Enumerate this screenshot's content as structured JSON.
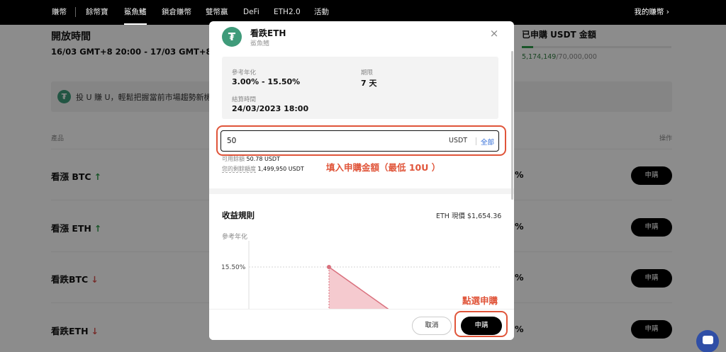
{
  "nav": {
    "items": [
      {
        "label": "賺幣",
        "active": false
      },
      {
        "label": "餘幣寶",
        "active": false
      },
      {
        "label": "鯊魚鰭",
        "active": true
      },
      {
        "label": "鎖倉賺幣",
        "active": false
      },
      {
        "label": "雙幣贏",
        "active": false
      },
      {
        "label": "DeFi",
        "active": false
      },
      {
        "label": "ETH2.0",
        "active": false
      },
      {
        "label": "活動",
        "active": false
      }
    ],
    "my_earn": "我的賺幣 ›"
  },
  "page": {
    "open_title": "開放時間",
    "open_range": "16/03 GMT+8 20:00 - 17/03 GMT+8 20:00",
    "subscribed_title": "已申購 USDT 金額",
    "subscribed_amount": "5,174,149",
    "subscribed_total": "/70,000,000",
    "subscribed_ratio": 0.074,
    "banner_icon": "₮",
    "banner_text": "投 U 賺 U，輕鬆把握當前市場趨勢新機",
    "col_product": "產品",
    "col_action": "操作",
    "products": [
      {
        "name": "看漲 BTC",
        "arrow": "↑",
        "dir": "up",
        "pct": "%",
        "button": "申購"
      },
      {
        "name": "看漲 ETH",
        "arrow": "↑",
        "dir": "up",
        "pct": "%",
        "button": "申購"
      },
      {
        "name": "看跌BTC",
        "arrow": "↓",
        "dir": "down",
        "pct": "%",
        "button": "申購"
      },
      {
        "name": "看跌ETH",
        "arrow": "↓",
        "dir": "down",
        "pct": "%",
        "button": "申購"
      }
    ]
  },
  "modal": {
    "icon": "₮",
    "title": "看跌ETH",
    "subtitle": "鯊魚鰭",
    "close_icon": "×",
    "apr_label": "參考年化",
    "apr_value": "3.00% - 15.50%",
    "term_label": "期限",
    "term_value": "7 天",
    "settle_label": "結算時間",
    "settle_value": "24/03/2023 18:00",
    "amount_value": "50",
    "amount_unit": "USDT",
    "amount_all": "全部",
    "available_label": "可用餘額",
    "available_value": "50.78 USDT",
    "quota_label": "您的剩餘額度",
    "quota_value": "1,499,950 USDT",
    "tip_amount": "填入申購金額（最低 10U ）",
    "rules_title": "收益規則",
    "price_now": "ETH 現價 $1,654.36",
    "chart_ylabel": "參考年化",
    "cancel_label": "取消",
    "subscribe_label": "申購",
    "tip_button": "點選申購"
  },
  "chart_data": {
    "type": "area",
    "ylabel": "參考年化",
    "ytick_labels": [
      "15.50%"
    ],
    "series": [
      {
        "points": [
          [
            0,
            15.5
          ],
          [
            1,
            3.0
          ]
        ]
      }
    ],
    "color": "#e8a0a8"
  },
  "colors": {
    "accent": "#e0553a",
    "tether": "#3f9b7a",
    "link": "#2f6bd7",
    "up": "#2e9b4a",
    "down": "#d9534f"
  },
  "icons": {
    "banner": "tether-icon",
    "modal": "tether-icon",
    "close": "close-icon",
    "chat": "chat-icon"
  }
}
